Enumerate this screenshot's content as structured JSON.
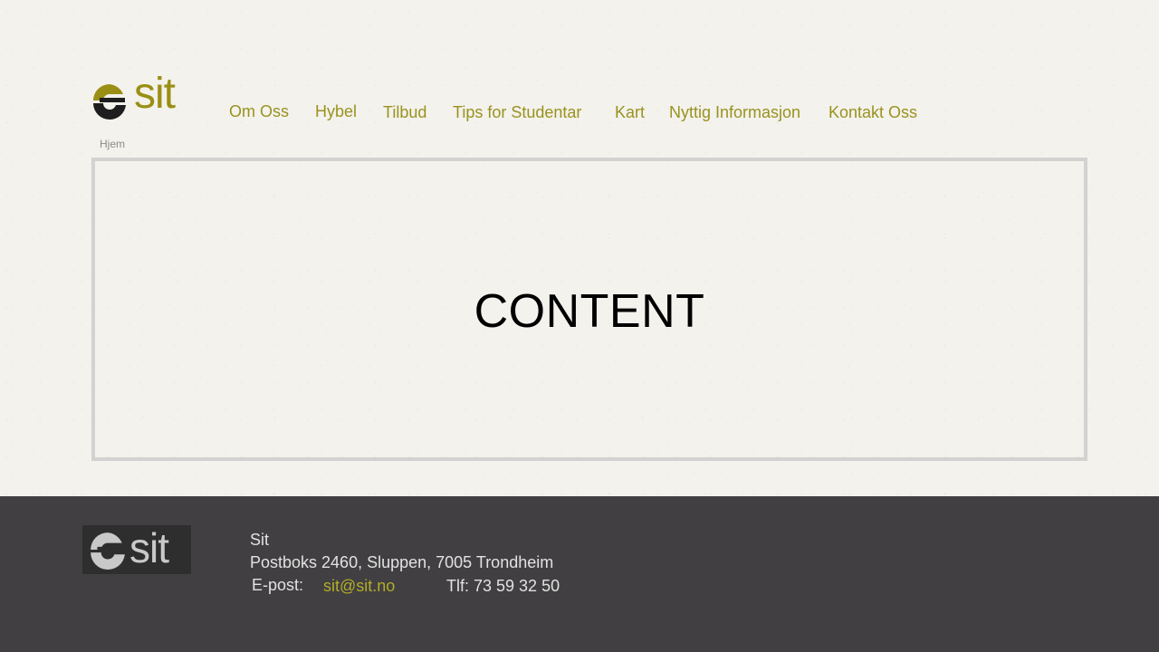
{
  "header": {
    "logo_text": "sit",
    "nav": [
      {
        "label": "Om Oss"
      },
      {
        "label": "Hybel"
      },
      {
        "label": "Tilbud"
      },
      {
        "label": "Tips for Studentar"
      },
      {
        "label": "Kart"
      },
      {
        "label": "Nyttig Informasjon"
      },
      {
        "label": "Kontakt Oss"
      }
    ]
  },
  "breadcrumb": "Hjem",
  "main": {
    "content_label": "CONTENT"
  },
  "footer": {
    "logo_text": "sit",
    "company": "Sit",
    "address": "Postboks 2460, Sluppen, 7005 Trondheim",
    "email_label": "E-post:",
    "email": "sit@sit.no",
    "phone": "Tlf: 73 59 32 50"
  },
  "colors": {
    "accent": "#9a9220",
    "background": "#f3f2ec",
    "footer_bg": "#413f41",
    "border": "#d2d2d0"
  }
}
